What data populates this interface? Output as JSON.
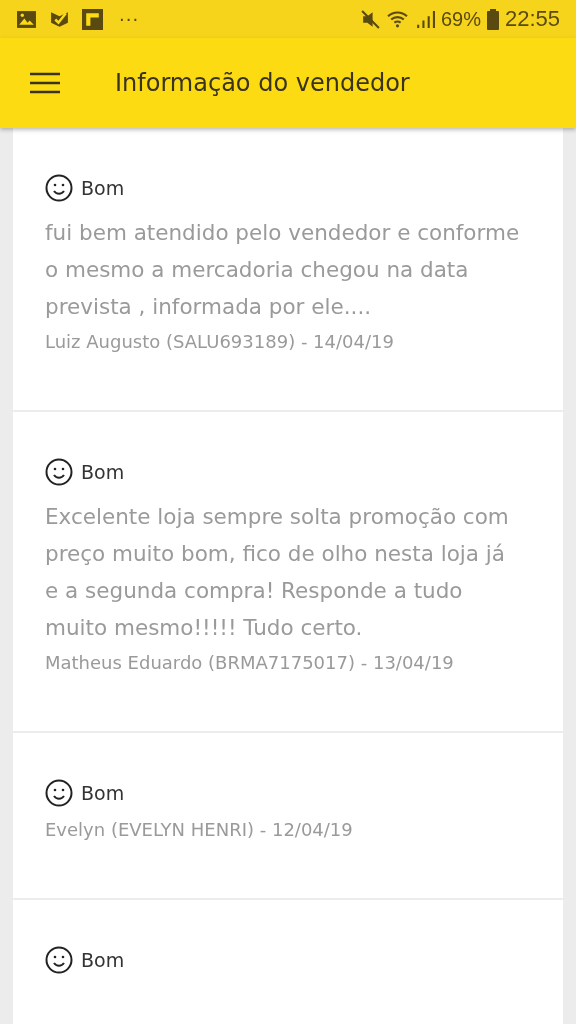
{
  "status_bar": {
    "more": "···",
    "battery": "69%",
    "time": "22:55"
  },
  "app_bar": {
    "title": "Informação do vendedor"
  },
  "reviews": [
    {
      "rating": "Bom",
      "comment": "fui bem atendido pelo vendedor e conforme o mesmo a mercadoria chegou na  data prevista , informada por ele....",
      "author": "Luiz Augusto (SALU693189) - 14/04/19"
    },
    {
      "rating": "Bom",
      "comment": "Excelente loja sempre solta promoção com preço muito bom, fico de olho nesta loja já e a segunda compra! Responde a tudo muito mesmo!!!!! Tudo certo.",
      "author": "Matheus Eduardo (BRMA7175017) - 13/04/19"
    },
    {
      "rating": "Bom",
      "author": "Evelyn (EVELYN HENRI) - 12/04/19"
    },
    {
      "rating": "Bom"
    }
  ]
}
